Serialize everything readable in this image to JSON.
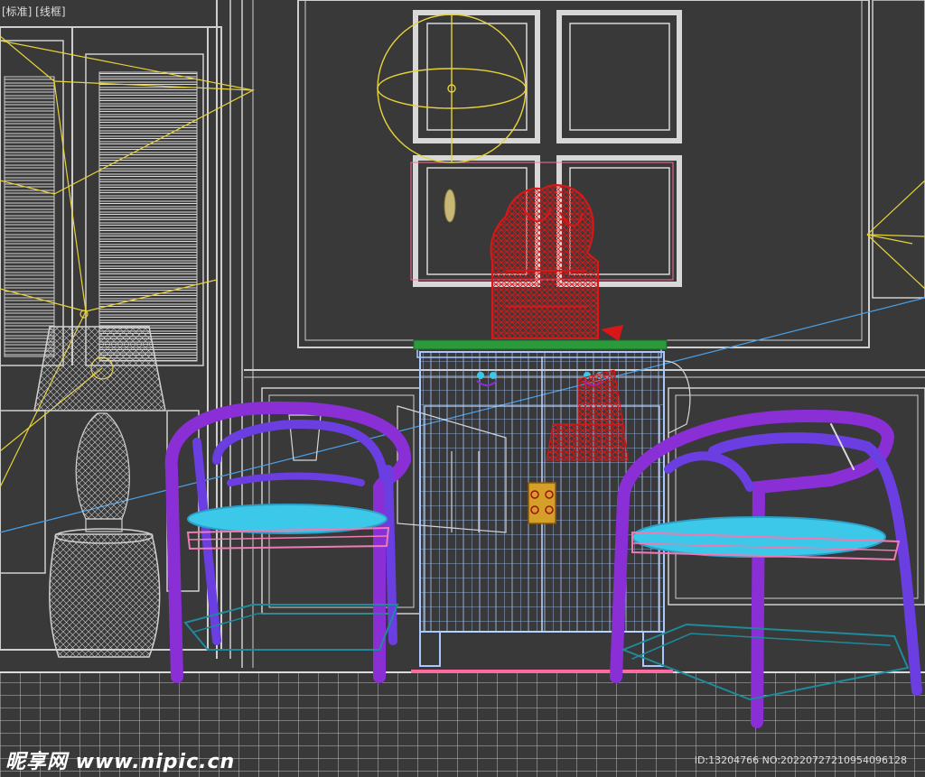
{
  "viewport": {
    "label": "[标准] [线框]"
  },
  "watermark": {
    "logo_text": "昵享网 www.nipic.cn",
    "id_text": "ID:13204766 NO:20220727210954096128"
  },
  "colors": {
    "background": "#393939",
    "wireframe_gray": "#c8c8c8",
    "light_yellow": "#e6d23a",
    "chair_purple": "#8a2ed6",
    "chair_violet": "#6a3ee0",
    "seat_cyan": "#3cc8e8",
    "seat_pink": "#f07ab4",
    "cabinet_blue": "#a8c8ff",
    "sculpture_red": "#d81818",
    "tray_green": "#2a9a3a",
    "base_teal": "#1e8a9a"
  },
  "objects": [
    {
      "name": "window-shutter-left"
    },
    {
      "name": "wall-panel-frames"
    },
    {
      "name": "picture-frames"
    },
    {
      "name": "table-lamp"
    },
    {
      "name": "drum-stool"
    },
    {
      "name": "armchair-left"
    },
    {
      "name": "armchair-right"
    },
    {
      "name": "side-cabinet"
    },
    {
      "name": "red-sculpture"
    },
    {
      "name": "omni-light-sphere"
    },
    {
      "name": "floor-grid"
    }
  ]
}
